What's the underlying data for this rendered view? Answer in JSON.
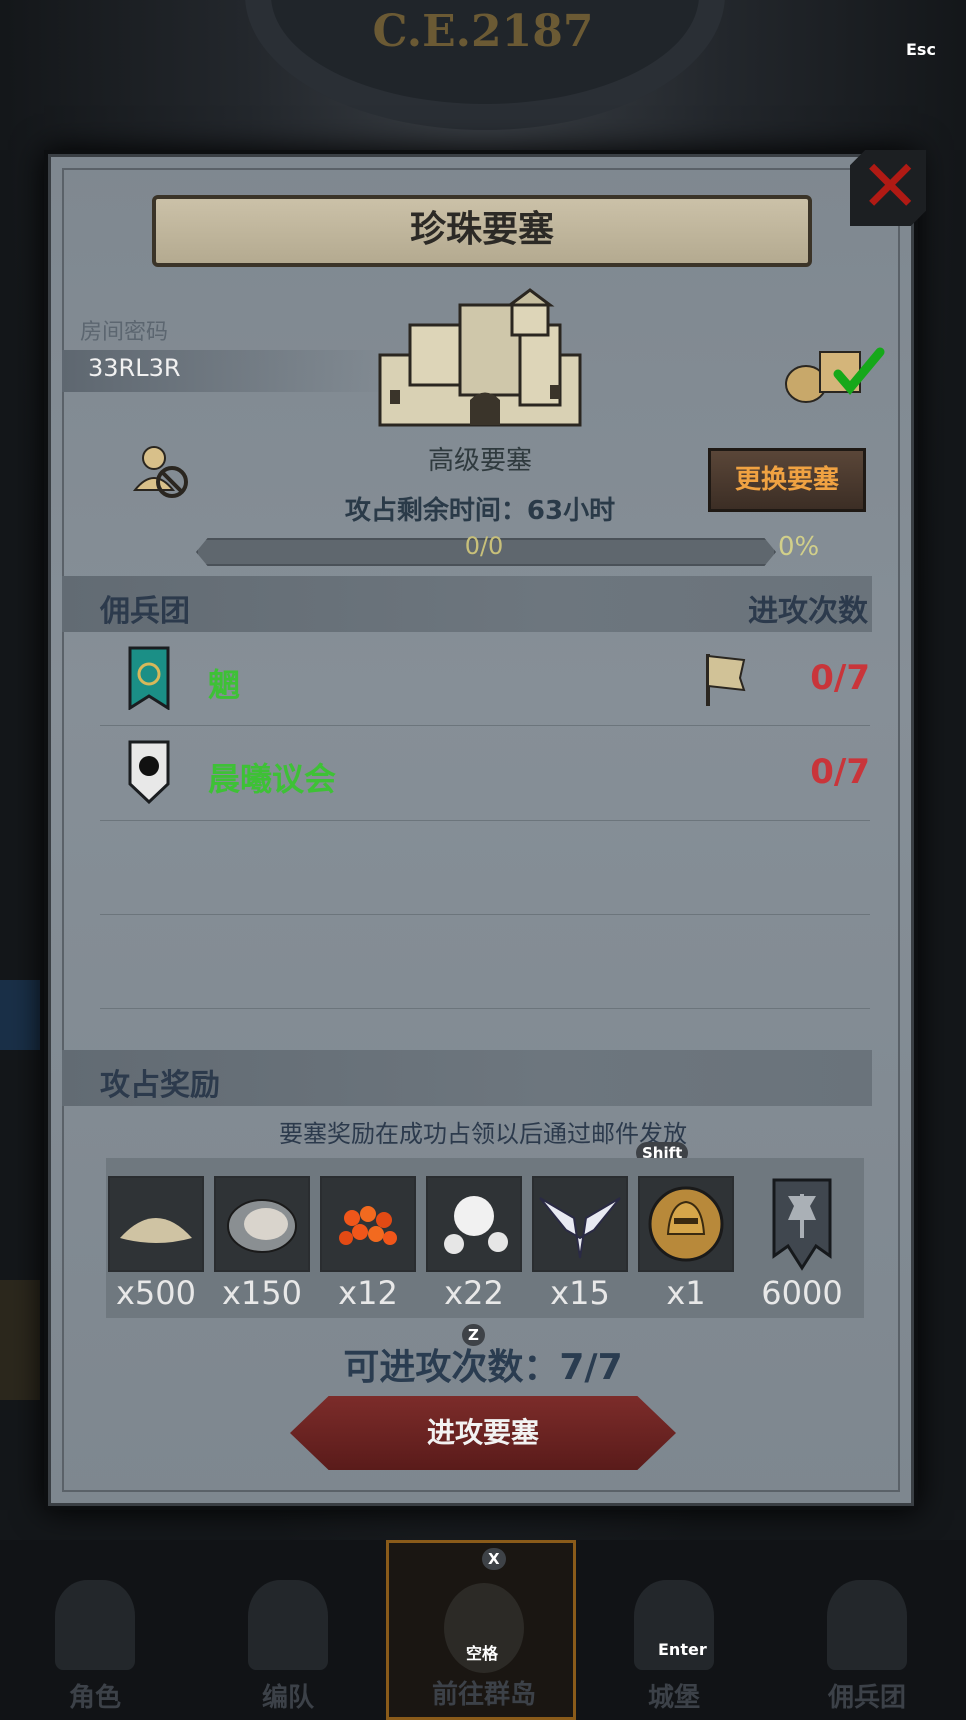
{
  "era": "C.E.2187",
  "title": "珍珠要塞",
  "room": {
    "label": "房间密码",
    "code": "33RL3R"
  },
  "castle": {
    "name": "高级要塞"
  },
  "change_button": "更换要塞",
  "remaining_time": "攻占剩余时间：63小时",
  "progress": {
    "text": "0/0",
    "percent": "0%",
    "fraction": 0
  },
  "mercenaries": {
    "header_left": "佣兵团",
    "header_right": "进攻次数",
    "rows": [
      {
        "name": "魍",
        "attacks": "0/7",
        "banner_color": "#1b8f86"
      },
      {
        "name": "晨曦议会",
        "attacks": "0/7",
        "banner_color": "#555a60"
      }
    ]
  },
  "rewards": {
    "header": "攻占奖励",
    "note": "要塞奖励在成功占领以后通过邮件发放",
    "items": [
      {
        "icon": "sand-icon",
        "qty": "x500"
      },
      {
        "icon": "oyster-icon",
        "qty": "x150"
      },
      {
        "icon": "roe-icon",
        "qty": "x12"
      },
      {
        "icon": "pearl-icon",
        "qty": "x22"
      },
      {
        "icon": "wing-emblem-icon",
        "qty": "x15"
      },
      {
        "icon": "helmet-coin-icon",
        "qty": "x1"
      },
      {
        "icon": "banner-icon",
        "qty": "6000"
      }
    ]
  },
  "can_attack": "可进攻次数：7/7",
  "attack_button": "进攻要塞",
  "nav": [
    {
      "label": "角色"
    },
    {
      "label": "编队"
    },
    {
      "label": "前往群岛"
    },
    {
      "label": "城堡"
    },
    {
      "label": "佣兵团"
    }
  ],
  "hints": {
    "esc": "Esc",
    "shift": "Shift",
    "z": "Z",
    "x": "X",
    "space": "空格",
    "enter": "Enter"
  },
  "colors": {
    "guild_name": "#3ec136",
    "attacks": "#c9353a",
    "change_btn_text": "#f0a242"
  }
}
